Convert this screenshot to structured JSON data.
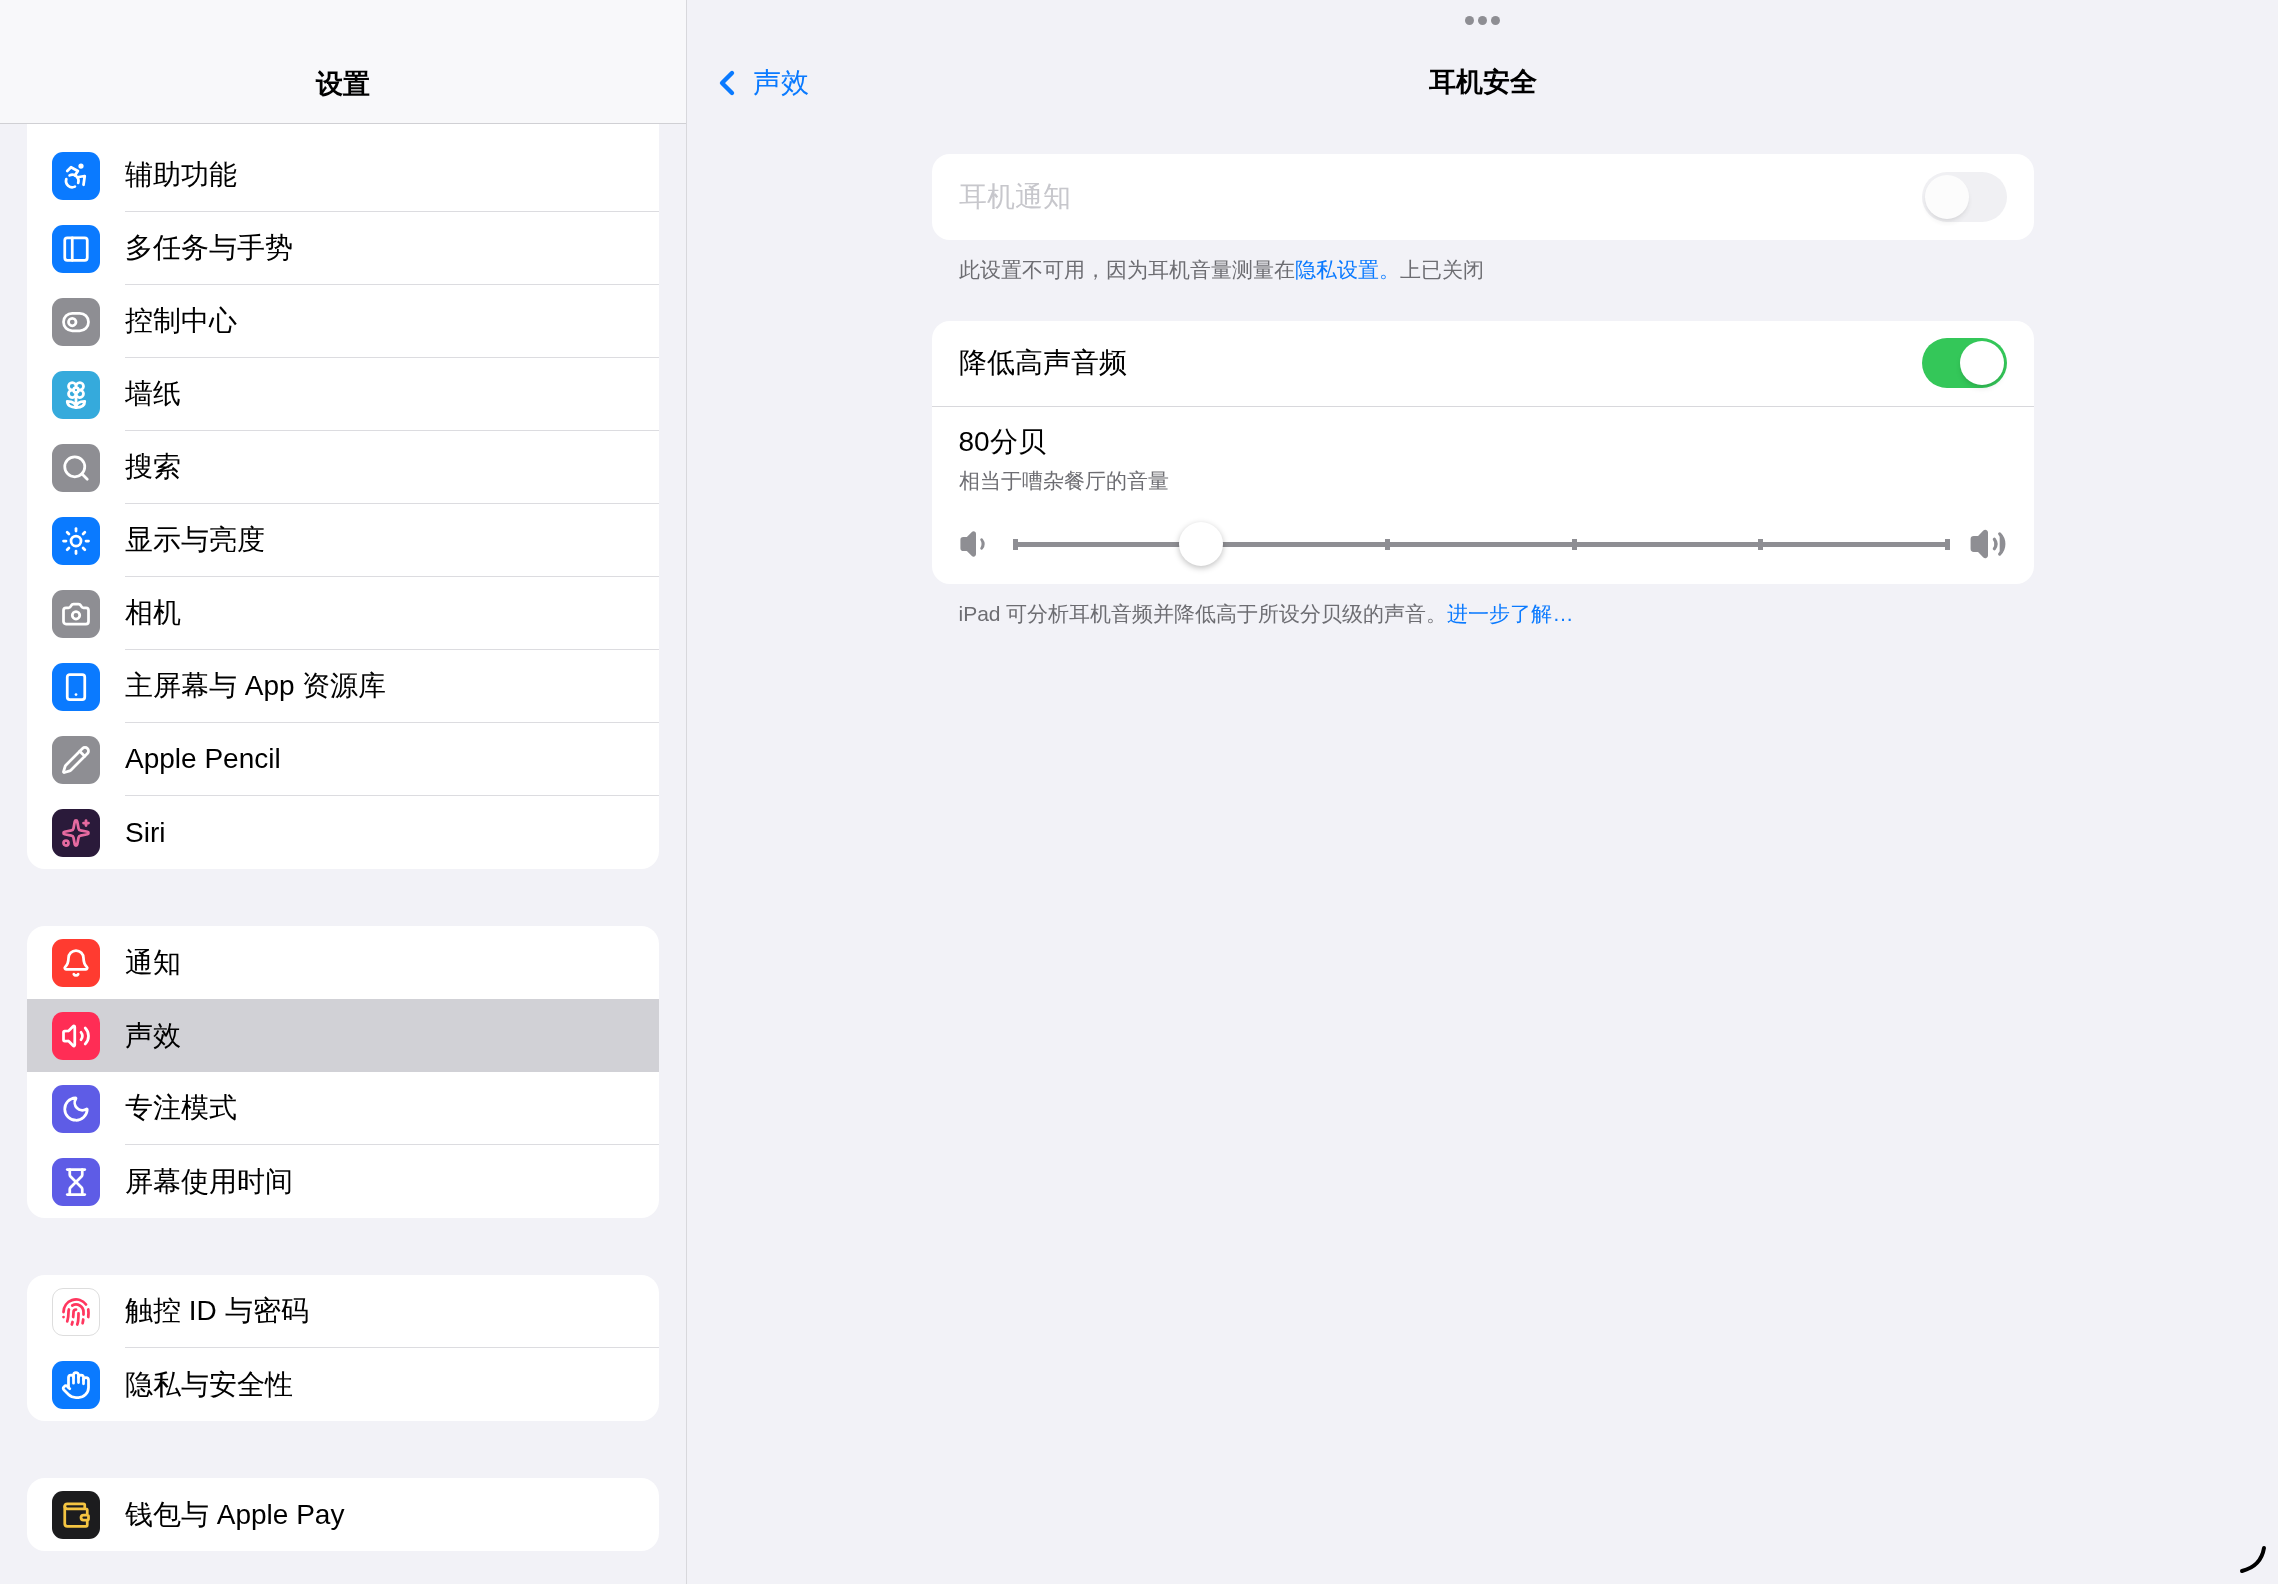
{
  "sidebar": {
    "title": "设置",
    "groups": [
      {
        "items": [
          {
            "label": "辅助功能",
            "selected": false
          },
          {
            "label": "多任务与手势",
            "selected": false
          },
          {
            "label": "控制中心",
            "selected": false
          },
          {
            "label": "墙纸",
            "selected": false
          },
          {
            "label": "搜索",
            "selected": false
          },
          {
            "label": "显示与亮度",
            "selected": false
          },
          {
            "label": "相机",
            "selected": false
          },
          {
            "label": "主屏幕与 App 资源库",
            "selected": false
          },
          {
            "label": "Apple Pencil",
            "selected": false
          },
          {
            "label": "Siri",
            "selected": false
          }
        ]
      },
      {
        "items": [
          {
            "label": "通知",
            "selected": false
          },
          {
            "label": "声效",
            "selected": true
          },
          {
            "label": "专注模式",
            "selected": false
          },
          {
            "label": "屏幕使用时间",
            "selected": false
          }
        ]
      },
      {
        "items": [
          {
            "label": "触控 ID 与密码",
            "selected": false
          },
          {
            "label": "隐私与安全性",
            "selected": false
          }
        ]
      },
      {
        "items": [
          {
            "label": "钱包与 Apple Pay",
            "selected": false
          }
        ]
      }
    ]
  },
  "detail": {
    "back_label": "声效",
    "title": "耳机安全",
    "headphone_notifications": {
      "label": "耳机通知",
      "on": false,
      "disabled": true,
      "footnote": {
        "text": "此设置不可用，因为耳机音量测量在",
        "link": "隐私设置。",
        "text_after": "上已关闭"
      }
    },
    "reduce_loud_audio": {
      "label": "降低高声音频",
      "on": true,
      "disabled": false,
      "value": "80分贝",
      "description": "相当于嘈杂餐厅的音量",
      "level": 0.2,
      "footnote": {
        "text": "iPad 可分析耳机音频并降低高于所设分贝级的声音。",
        "link": "进一步了解…"
      }
    }
  }
}
